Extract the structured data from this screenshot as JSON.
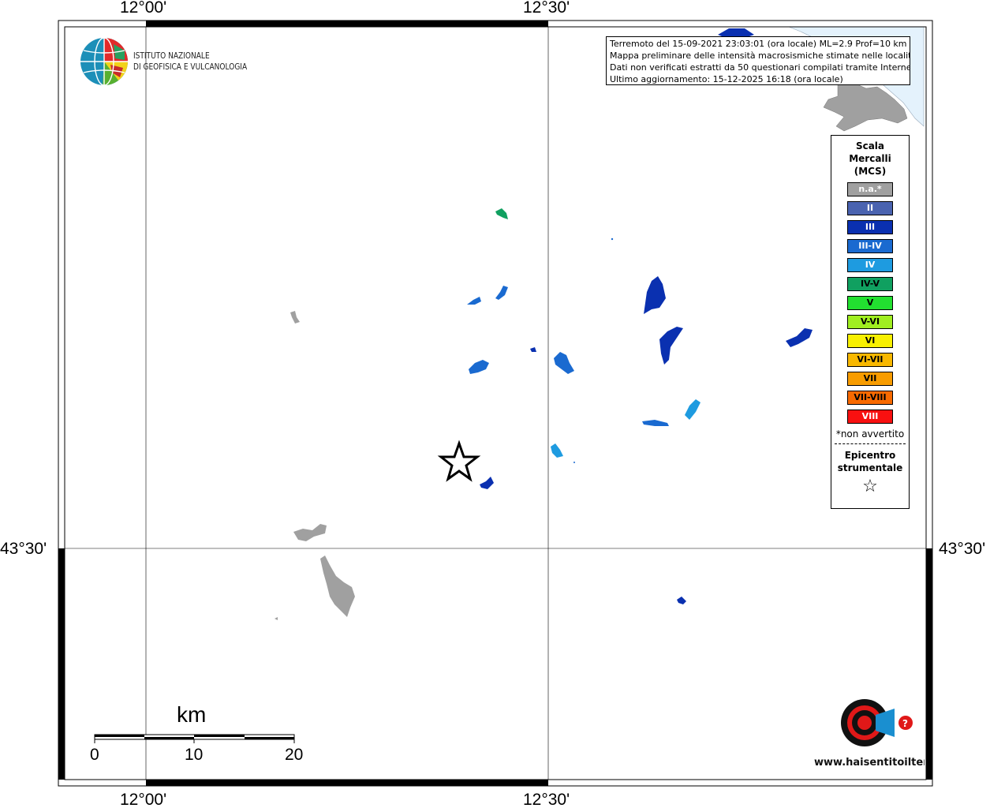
{
  "map": {
    "lon_labels": [
      "12°00'",
      "12°30'"
    ],
    "lat_labels": [
      "43°30'"
    ],
    "colors": {
      "na": "#a0a0a0",
      "II": "#4a63b0",
      "III": "#0a30b0",
      "III-IV": "#1a6ad0",
      "IV": "#1e9be0",
      "IV-V": "#10a060",
      "V": "#22e030",
      "V-VI": "#a0ee20",
      "VI": "#f8f000",
      "VI-VII": "#f8b800",
      "VII": "#f89c00",
      "VII-VIII": "#f86a00",
      "VIII": "#f81010",
      "sea": "#e4f2fc"
    }
  },
  "info": {
    "line1": "Terremoto del 15-09-2021 23:03:01 (ora locale) ML=2.9 Prof=10 km",
    "line2": "Mappa preliminare delle intensità macrosismiche stimate nelle località",
    "line3": "Dati non verificati estratti da 50 questionari compilati tramite Internet.",
    "line4": "Ultimo aggiornamento: 15-12-2025 16:18 (ora locale)"
  },
  "logo": {
    "line1": "ISTITUTO NAZIONALE",
    "line2": "DI GEOFISICA E VULCANOLOGIA"
  },
  "legend": {
    "title1": "Scala",
    "title2": "Mercalli",
    "title3": "(MCS)",
    "items": [
      {
        "label": "n.a.*",
        "color": "#a0a0a0",
        "dark": false
      },
      {
        "label": "II",
        "color": "#4a63b0",
        "dark": false
      },
      {
        "label": "III",
        "color": "#0a30b0",
        "dark": false
      },
      {
        "label": "III-IV",
        "color": "#1a6ad0",
        "dark": false
      },
      {
        "label": "IV",
        "color": "#1e9be0",
        "dark": false
      },
      {
        "label": "IV-V",
        "color": "#10a060",
        "dark": true
      },
      {
        "label": "V",
        "color": "#22e030",
        "dark": true
      },
      {
        "label": "V-VI",
        "color": "#a0ee20",
        "dark": true
      },
      {
        "label": "VI",
        "color": "#f8f000",
        "dark": true
      },
      {
        "label": "VI-VII",
        "color": "#f8b800",
        "dark": true
      },
      {
        "label": "VII",
        "color": "#f89c00",
        "dark": true
      },
      {
        "label": "VII-VIII",
        "color": "#f86a00",
        "dark": true
      },
      {
        "label": "VIII",
        "color": "#f81010",
        "dark": false
      }
    ],
    "note": "*non avvertito",
    "epicenter1": "Epicentro",
    "epicenter2": "strumentale",
    "star": "☆"
  },
  "scale": {
    "unit": "km",
    "ticks": [
      "0",
      "10",
      "20"
    ]
  },
  "hai_logo": {
    "text": "www.haisentitoilterremoto.it"
  }
}
